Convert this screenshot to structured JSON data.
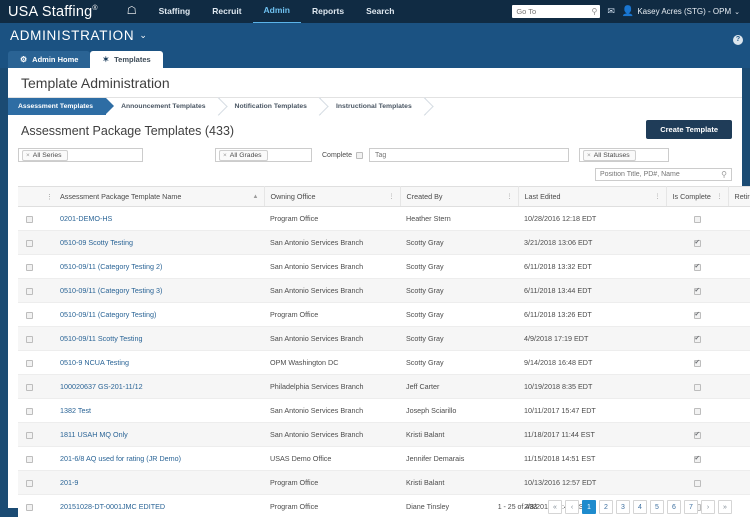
{
  "topnav": {
    "brand": "USA Staffing",
    "brand_reg": "®",
    "home_icon": "home-icon",
    "links": [
      {
        "label": "Staffing",
        "active": false
      },
      {
        "label": "Recruit",
        "active": false
      },
      {
        "label": "Admin",
        "active": true
      },
      {
        "label": "Reports",
        "active": false
      },
      {
        "label": "Search",
        "active": false
      }
    ],
    "goto_placeholder": "Go To",
    "goto_value": "",
    "mail_icon": "envelope-icon",
    "user_icon": "person-icon",
    "user_name": "Kasey Acres (STG) - OPM",
    "user_caret": "⌄"
  },
  "adminband": {
    "title": "ADMINISTRATION",
    "caret": "⌄",
    "help": "?"
  },
  "apptabs": [
    {
      "label": "Admin Home",
      "icon": "gear-icon",
      "glyph": "⚙",
      "active": false
    },
    {
      "label": "Templates",
      "icon": "puzzle-icon",
      "glyph": "✶",
      "active": true
    }
  ],
  "page": {
    "title": "Template Administration"
  },
  "crumbs": [
    {
      "label": "Assessment Templates",
      "selected": true
    },
    {
      "label": "Announcement Templates",
      "selected": false
    },
    {
      "label": "Notification Templates",
      "selected": false
    },
    {
      "label": "Instructional Templates",
      "selected": false
    }
  ],
  "panel": {
    "title": "Assessment Package Templates (433)",
    "create_button": "Create Template"
  },
  "filters": {
    "series": {
      "pill": "All Series",
      "x": "×"
    },
    "grades": {
      "pill": "All Grades",
      "x": "×"
    },
    "statuses": {
      "pill": "All Statuses",
      "x": "×"
    },
    "complete_label": "Complete",
    "complete_checked": false,
    "tag_placeholder": "Tag",
    "tag_value": "",
    "search_placeholder": "Position Title, PD#, Name",
    "search_value": "",
    "search_icon": "search-icon"
  },
  "table": {
    "columns": [
      {
        "key": "check",
        "label": ""
      },
      {
        "key": "grip",
        "label": "⋮"
      },
      {
        "key": "name",
        "label": "Assessment Package Template Name",
        "sort": "▲"
      },
      {
        "key": "office",
        "label": "Owning Office",
        "sort": "⋮"
      },
      {
        "key": "by",
        "label": "Created By",
        "sort": "⋮"
      },
      {
        "key": "edited",
        "label": "Last Edited",
        "sort": "⋮"
      },
      {
        "key": "complete",
        "label": "Is Complete",
        "sort": "⋮"
      },
      {
        "key": "retired",
        "label": "Retired",
        "sort": "⋮"
      }
    ],
    "rows": [
      {
        "name": "0201-DEMO-HS",
        "office": "Program Office",
        "by": "Heather Stern",
        "edited": "10/28/2016 12:18 EDT",
        "complete": false,
        "retired": false
      },
      {
        "name": "0510-09 Scotty Testing",
        "office": "San Antonio Services Branch",
        "by": "Scotty Gray",
        "edited": "3/21/2018 13:06 EDT",
        "complete": true,
        "retired": false
      },
      {
        "name": "0510-09/11 (Category Testing 2)",
        "office": "San Antonio Services Branch",
        "by": "Scotty Gray",
        "edited": "6/11/2018 13:32 EDT",
        "complete": true,
        "retired": true
      },
      {
        "name": "0510-09/11 (Category Testing 3)",
        "office": "San Antonio Services Branch",
        "by": "Scotty Gray",
        "edited": "6/11/2018 13:44 EDT",
        "complete": true,
        "retired": false
      },
      {
        "name": "0510-09/11 (Category Testing)",
        "office": "Program Office",
        "by": "Scotty Gray",
        "edited": "6/11/2018 13:26 EDT",
        "complete": true,
        "retired": false
      },
      {
        "name": "0510-09/11 Scotty Testing",
        "office": "San Antonio Services Branch",
        "by": "Scotty Gray",
        "edited": "4/9/2018 17:19 EDT",
        "complete": true,
        "retired": false
      },
      {
        "name": "0510-9 NCUA Testing",
        "office": "OPM Washington DC",
        "by": "Scotty Gray",
        "edited": "9/14/2018 16:48 EDT",
        "complete": true,
        "retired": false
      },
      {
        "name": "100020637 GS-201-11/12",
        "office": "Philadelphia Services Branch",
        "by": "Jeff Carter",
        "edited": "10/19/2018 8:35 EDT",
        "complete": false,
        "retired": false
      },
      {
        "name": "1382 Test",
        "office": "San Antonio Services Branch",
        "by": "Joseph Sciarillo",
        "edited": "10/11/2017 15:47 EDT",
        "complete": false,
        "retired": false
      },
      {
        "name": "1811 USAH MQ Only",
        "office": "San Antonio Services Branch",
        "by": "Kristi Balant",
        "edited": "11/18/2017 11:44 EST",
        "complete": true,
        "retired": false
      },
      {
        "name": "201-6/8 AQ used for rating (JR Demo)",
        "office": "USAS Demo Office",
        "by": "Jennifer Demarais",
        "edited": "11/15/2018 14:51 EST",
        "complete": true,
        "retired": false
      },
      {
        "name": "201-9",
        "office": "Program Office",
        "by": "Kristi Balant",
        "edited": "10/13/2016 12:57 EDT",
        "complete": false,
        "retired": false
      },
      {
        "name": "20151028-DT-0001JMC EDITED",
        "office": "Program Office",
        "by": "Diane Tinsley",
        "edited": "2/8/2016 10:49 EST",
        "complete": false,
        "retired": false
      }
    ]
  },
  "pagination": {
    "summary": "1 - 25 of 433",
    "first": "«",
    "prev": "‹",
    "pages": [
      "1",
      "2",
      "3",
      "4",
      "5",
      "6",
      "7"
    ],
    "current": "1",
    "next": "›",
    "last": "»"
  }
}
